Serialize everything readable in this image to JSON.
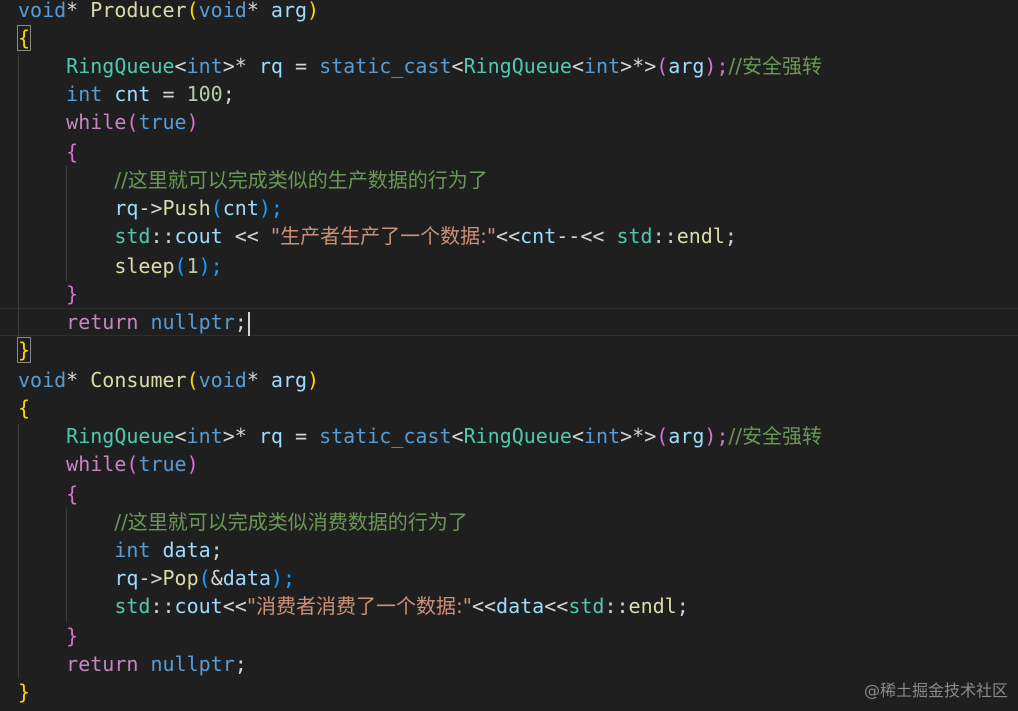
{
  "producer": {
    "sig_ret": "void",
    "sig_star": "* ",
    "sig_name": "Producer",
    "sig_open": "(",
    "sig_ptype": "void",
    "sig_pstar": "* ",
    "sig_pname": "arg",
    "sig_close": ")",
    "open_brace": "{",
    "rq_type": "RingQueue",
    "rq_lt": "<",
    "rq_int": "int",
    "rq_gt_star": ">* ",
    "rq_var": "rq",
    "rq_eq": " = ",
    "rq_cast": "static_cast",
    "rq_lt2": "<",
    "rq_type2": "RingQueue",
    "rq_lt3": "<",
    "rq_int2": "int",
    "rq_gt2": ">*>",
    "rq_po": "(",
    "rq_arg": "arg",
    "rq_pc": ");",
    "rq_comment": "//安全强转",
    "cnt_type": "int",
    "cnt_var": " cnt",
    "cnt_eq": " = ",
    "cnt_val": "100",
    "cnt_semi": ";",
    "while_kw": "while",
    "while_open": "(",
    "while_true": "true",
    "while_close": ")",
    "loop_open": "{",
    "loop_comment": "//这里就可以完成类似的生产数据的行为了",
    "push_rq": "rq",
    "push_arrow": "->",
    "push_fn": "Push",
    "push_open": "(",
    "push_cnt": "cnt",
    "push_close": ");",
    "cout_std": "std",
    "cout_ns": "::",
    "cout_var": "cout",
    "cout_op": " << ",
    "cout_str": "\"生产者生产了一个数据:\"",
    "cout_op2": "<<",
    "cout_cnt": "cnt",
    "cout_dec": "--",
    "cout_op3": "<< ",
    "cout_std2": "std",
    "cout_ns2": "::",
    "cout_endl": "endl",
    "cout_semi": ";",
    "sleep_fn": "sleep",
    "sleep_open": "(",
    "sleep_num": "1",
    "sleep_close": ");",
    "loop_close": "}",
    "ret_kw": "return",
    "ret_val": " nullptr",
    "ret_semi": ";",
    "close_brace": "}"
  },
  "consumer": {
    "sig_ret": "void",
    "sig_star": "* ",
    "sig_name": "Consumer",
    "sig_open": "(",
    "sig_ptype": "void",
    "sig_pstar": "* ",
    "sig_pname": "arg",
    "sig_close": ")",
    "open_brace": "{",
    "rq_type": "RingQueue",
    "rq_lt": "<",
    "rq_int": "int",
    "rq_gt_star": ">* ",
    "rq_var": "rq",
    "rq_eq": " = ",
    "rq_cast": "static_cast",
    "rq_lt2": "<",
    "rq_type2": "RingQueue",
    "rq_lt3": "<",
    "rq_int2": "int",
    "rq_gt2": ">*>",
    "rq_po": "(",
    "rq_arg": "arg",
    "rq_pc": ");",
    "rq_comment": "//安全强转",
    "while_kw": "while",
    "while_open": "(",
    "while_true": "true",
    "while_close": ")",
    "loop_open": "{",
    "loop_comment": "//这里就可以完成类似消费数据的行为了",
    "data_type": "int",
    "data_var": " data",
    "data_semi": ";",
    "pop_rq": "rq",
    "pop_arrow": "->",
    "pop_fn": "Pop",
    "pop_open": "(",
    "pop_amp": "&",
    "pop_data": "data",
    "pop_close": ");",
    "cout_std": "std",
    "cout_ns": "::",
    "cout_var": "cout",
    "cout_op": "<<",
    "cout_str": "\"消费者消费了一个数据:\"",
    "cout_op2": "<<",
    "cout_data": "data",
    "cout_op3": "<<",
    "cout_std2": "std",
    "cout_ns2": "::",
    "cout_endl": "endl",
    "cout_semi": ";",
    "loop_close": "}",
    "ret_kw": "return",
    "ret_val": " nullptr",
    "ret_semi": ";",
    "close_brace": "}"
  },
  "watermark": "@稀土掘金技术社区"
}
